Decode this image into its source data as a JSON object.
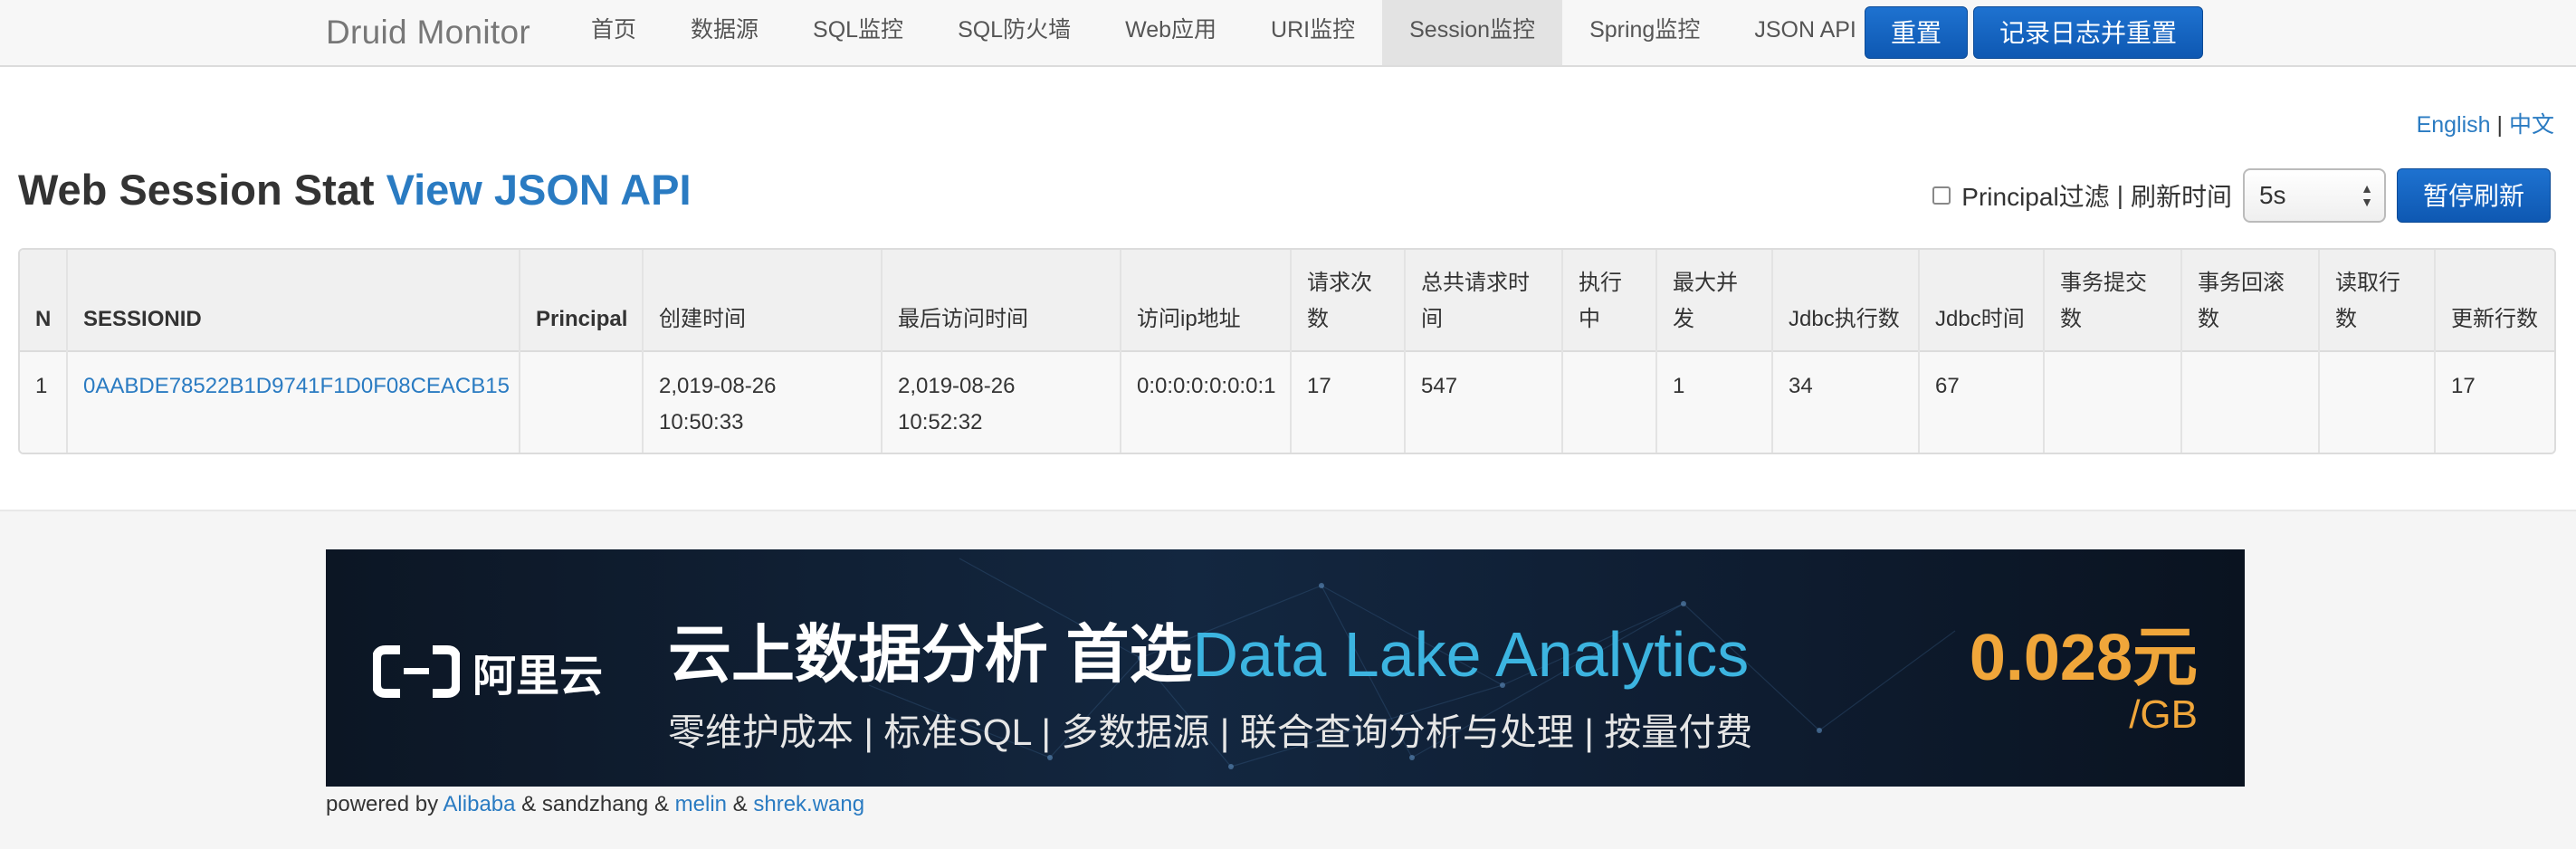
{
  "navbar": {
    "brand": "Druid Monitor",
    "items": [
      {
        "label": "首页"
      },
      {
        "label": "数据源"
      },
      {
        "label": "SQL监控"
      },
      {
        "label": "SQL防火墙"
      },
      {
        "label": "Web应用"
      },
      {
        "label": "URI监控"
      },
      {
        "label": "Session监控",
        "active": true
      },
      {
        "label": "Spring监控"
      },
      {
        "label": "JSON API"
      }
    ],
    "reset_label": "重置",
    "log_reset_label": "记录日志并重置"
  },
  "lang": {
    "english": "English",
    "sep": "|",
    "chinese": "中文"
  },
  "heading": {
    "title": "Web Session Stat",
    "link": "View JSON API"
  },
  "controls": {
    "principal_filter": "Principal过滤",
    "sep": "|",
    "refresh_label": "刷新时间",
    "refresh_value": "5s",
    "pause_label": "暂停刷新"
  },
  "table": {
    "headers": [
      "N",
      "SESSIONID",
      "Principal",
      "创建时间",
      "最后访问时间",
      "访问ip地址",
      "请求次数",
      "总共请求时间",
      "执行中",
      "最大并发",
      "Jdbc执行数",
      "Jdbc时间",
      "事务提交数",
      "事务回滚数",
      "读取行数",
      "更新行数"
    ],
    "rows": [
      {
        "n": "1",
        "session_id": "0AABDE78522B1D9741F1D0F08CEACB15",
        "principal": "",
        "create_time": "2,019-08-26 10:50:33",
        "last_access_time": "2,019-08-26 10:52:32",
        "ip": "0:0:0:0:0:0:0:1",
        "request_count": "17",
        "request_time_total": "547",
        "running": "",
        "concurrent_max": "1",
        "jdbc_execute_count": "34",
        "jdbc_time": "67",
        "commit_count": "",
        "rollback_count": "",
        "fetch_row_count": "",
        "update_count": "17"
      }
    ]
  },
  "banner": {
    "logo_text": "阿里云",
    "headline_cn": "云上数据分析 首选",
    "headline_en": "Data Lake Analytics",
    "subline": "零维护成本 | 标准SQL | 多数据源 | 联合查询分析与处理 | 按量付费",
    "price": "0.028元",
    "unit": "/GB"
  },
  "footer": {
    "powered_by": "powered by",
    "alibaba": "Alibaba",
    "amp1": "&",
    "sandzhang": "sandzhang",
    "amp2": "&",
    "melin": "melin",
    "amp3": "&",
    "shrek": "shrek.wang"
  }
}
